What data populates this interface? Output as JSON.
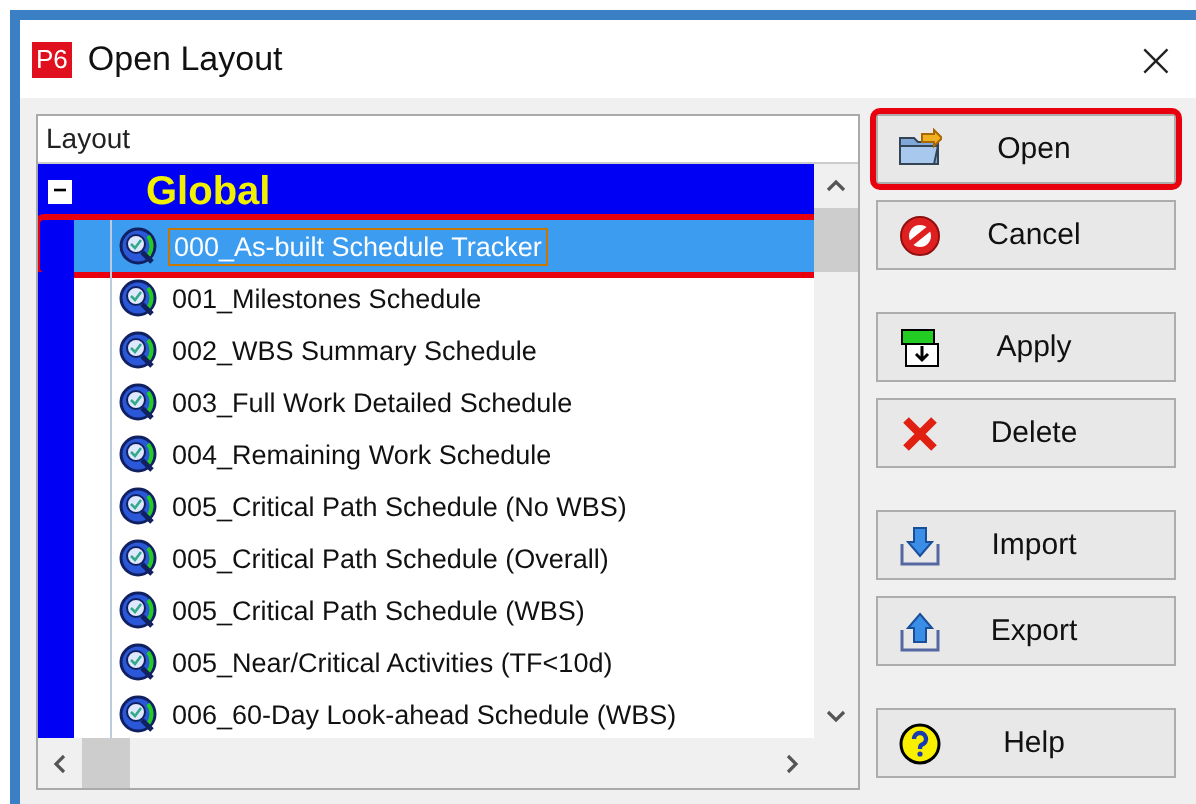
{
  "window": {
    "title": "Open Layout",
    "app_badge": "P6",
    "close": "×"
  },
  "list": {
    "header": "Layout",
    "group": {
      "label": "Global",
      "expanded": true,
      "toggle": "−"
    },
    "items": [
      {
        "label": "000_As-built Schedule Tracker",
        "selected": true,
        "highlighted": true
      },
      {
        "label": "001_Milestones Schedule",
        "selected": false,
        "highlighted": false
      },
      {
        "label": "002_WBS Summary Schedule",
        "selected": false,
        "highlighted": false
      },
      {
        "label": "003_Full Work Detailed Schedule",
        "selected": false,
        "highlighted": false
      },
      {
        "label": "004_Remaining Work Schedule",
        "selected": false,
        "highlighted": false
      },
      {
        "label": "005_Critical Path Schedule (No WBS)",
        "selected": false,
        "highlighted": false
      },
      {
        "label": "005_Critical Path Schedule (Overall)",
        "selected": false,
        "highlighted": false
      },
      {
        "label": "005_Critical Path Schedule (WBS)",
        "selected": false,
        "highlighted": false
      },
      {
        "label": "005_Near/Critical Activities (TF<10d)",
        "selected": false,
        "highlighted": false
      },
      {
        "label": "006_60-Day Look-ahead Schedule (WBS)",
        "selected": false,
        "highlighted": false
      }
    ]
  },
  "buttons": [
    {
      "label": "Open",
      "kind": "open",
      "highlighted": true
    },
    {
      "label": "Cancel",
      "kind": "cancel",
      "highlighted": false
    },
    {
      "label": "Apply",
      "kind": "apply",
      "highlighted": false
    },
    {
      "label": "Delete",
      "kind": "delete",
      "highlighted": false
    },
    {
      "label": "Import",
      "kind": "import",
      "highlighted": false
    },
    {
      "label": "Export",
      "kind": "export",
      "highlighted": false
    },
    {
      "label": "Help",
      "kind": "help",
      "highlighted": false
    }
  ]
}
